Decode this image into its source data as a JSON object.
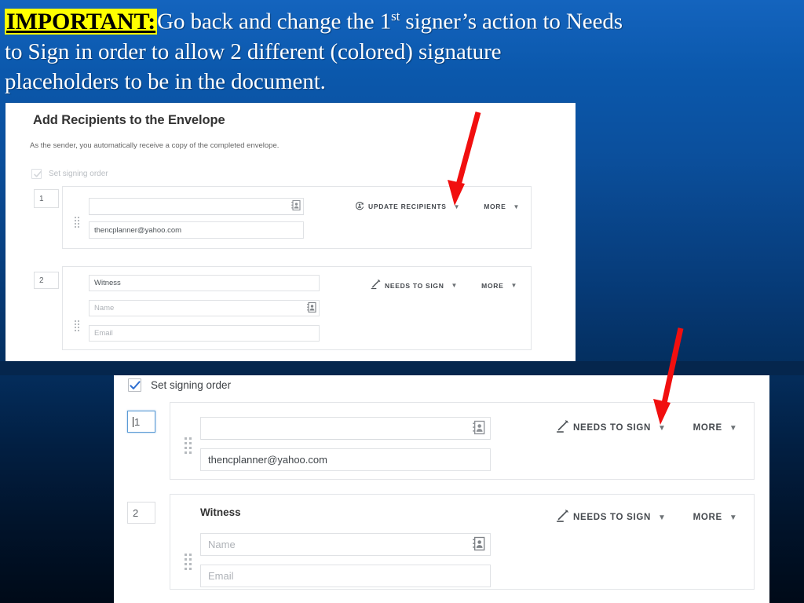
{
  "slide": {
    "header": {
      "badge": "IMPORTANT:",
      "line1_rest": "Go back and change the 1",
      "line1_sup": "st",
      "line1_tail": " signer’s action to Needs",
      "line2": "to Sign in order to allow 2 different (colored) signature",
      "line3": "placeholders to be in the document.",
      "highlight_color": "#ffff00",
      "text_color": "#ffffff"
    },
    "background_colors": {
      "top": "#1464be",
      "bottom": "#000a18"
    },
    "annotations": [
      {
        "name": "arrow-to-update-recipients",
        "color": "#ff0000"
      },
      {
        "name": "arrow-to-needs-to-sign",
        "color": "#ff0000"
      }
    ]
  },
  "screenshot_top": {
    "title": "Add Recipients to the Envelope",
    "subtitle": "As the sender, you automatically receive a copy of the completed envelope.",
    "signing_order": {
      "label": "Set signing order",
      "checked": true,
      "enabled": false
    },
    "recipients": [
      {
        "order": "1",
        "name_value": "",
        "name_placeholder": "",
        "email_value": "thencplanner@yahoo.com",
        "email_placeholder": "",
        "action_label": "UPDATE RECIPIENTS",
        "action_icon": "update-recipients-icon",
        "more_label": "MORE",
        "book_icon": "address-book-icon"
      },
      {
        "order": "2",
        "name_value": "Witness",
        "name_placeholder": "Name",
        "email_value": "",
        "email_placeholder": "Email",
        "action_label": "NEEDS TO SIGN",
        "action_icon": "pencil-icon",
        "more_label": "MORE",
        "book_icon": "address-book-icon"
      }
    ]
  },
  "screenshot_bottom": {
    "signing_order": {
      "label": "Set signing order",
      "checked": true,
      "enabled": true
    },
    "recipients": [
      {
        "order": "1",
        "order_focused": true,
        "name_value": "",
        "name_placeholder": "",
        "email_value": "thencplanner@yahoo.com",
        "email_placeholder": "",
        "action_label": "NEEDS TO SIGN",
        "action_icon": "pencil-icon",
        "more_label": "MORE",
        "book_icon": "address-book-icon"
      },
      {
        "order": "2",
        "order_focused": false,
        "group_label": "Witness",
        "name_value": "",
        "name_placeholder": "Name",
        "email_value": "",
        "email_placeholder": "Email",
        "action_label": "NEEDS TO SIGN",
        "action_icon": "pencil-icon",
        "more_label": "MORE",
        "book_icon": "address-book-icon"
      }
    ]
  }
}
